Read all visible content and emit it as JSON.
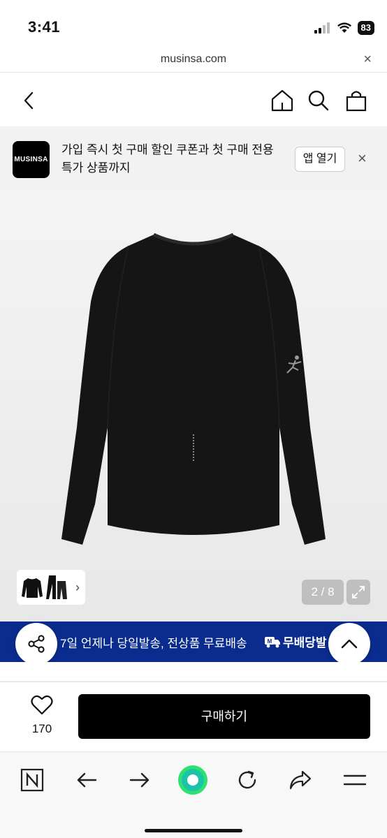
{
  "status": {
    "time": "3:41",
    "battery": "83"
  },
  "browser": {
    "url": "musinsa.com",
    "close": "×"
  },
  "nav": {
    "back_icon": "chevron-left-icon",
    "home_icon": "home-icon",
    "search_icon": "search-icon",
    "cart_icon": "shopping-bag-icon"
  },
  "banner": {
    "logo": "MUSINSA",
    "text": "가입 즉시 첫 구매 할인 쿠폰과 첫 구매 전용 특가 상품까지",
    "open_app": "앱 열기",
    "close": "×"
  },
  "gallery": {
    "counter": "2 / 8",
    "thumb_chevron": "›"
  },
  "promo": {
    "text": "7일 언제나 당일발송, 전상품 무료배송",
    "badge": "무배당발"
  },
  "buy": {
    "like_count": "170",
    "buy_label": "구매하기"
  },
  "colors": {
    "promo_bg": "#0b2c8f",
    "buy_bg": "#000000",
    "refresh_green": "#22c55e"
  }
}
